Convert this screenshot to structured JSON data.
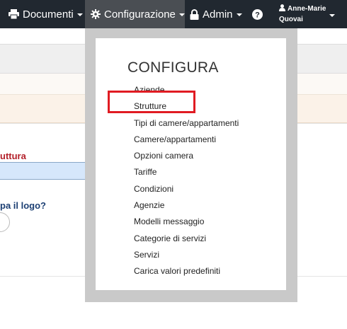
{
  "navbar": {
    "documenti_label": "Documenti",
    "configurazione_label": "Configurazione",
    "admin_label": "Admin",
    "help_icon": "question-circle-icon",
    "user_first": "Anne-Marie",
    "user_last": "Quovai"
  },
  "page": {
    "struttura_label": "uttura",
    "logo_label": "pa il logo?",
    "select_value": ""
  },
  "dropdown": {
    "heading": "CONFIGURA",
    "items": [
      {
        "label": "Aziende"
      },
      {
        "label": "Strutture"
      },
      {
        "label": "Tipi di camere/appartamenti"
      },
      {
        "label": "Camere/appartamenti"
      },
      {
        "label": "Opzioni camera"
      },
      {
        "label": "Tariffe"
      },
      {
        "label": "Condizioni"
      },
      {
        "label": "Agenzie"
      },
      {
        "label": "Modelli messaggio"
      },
      {
        "label": "Categorie di servizi"
      },
      {
        "label": "Servizi"
      },
      {
        "label": "Carica valori predefiniti"
      }
    ],
    "highlighted_item": "Strutture",
    "highlight_color": "#e01b22"
  },
  "colors": {
    "navbar_bg": "#212830",
    "active_nav_bg": "#4a4e53",
    "struttura_label": "#b3202a",
    "logo_label": "#1c3f73"
  }
}
